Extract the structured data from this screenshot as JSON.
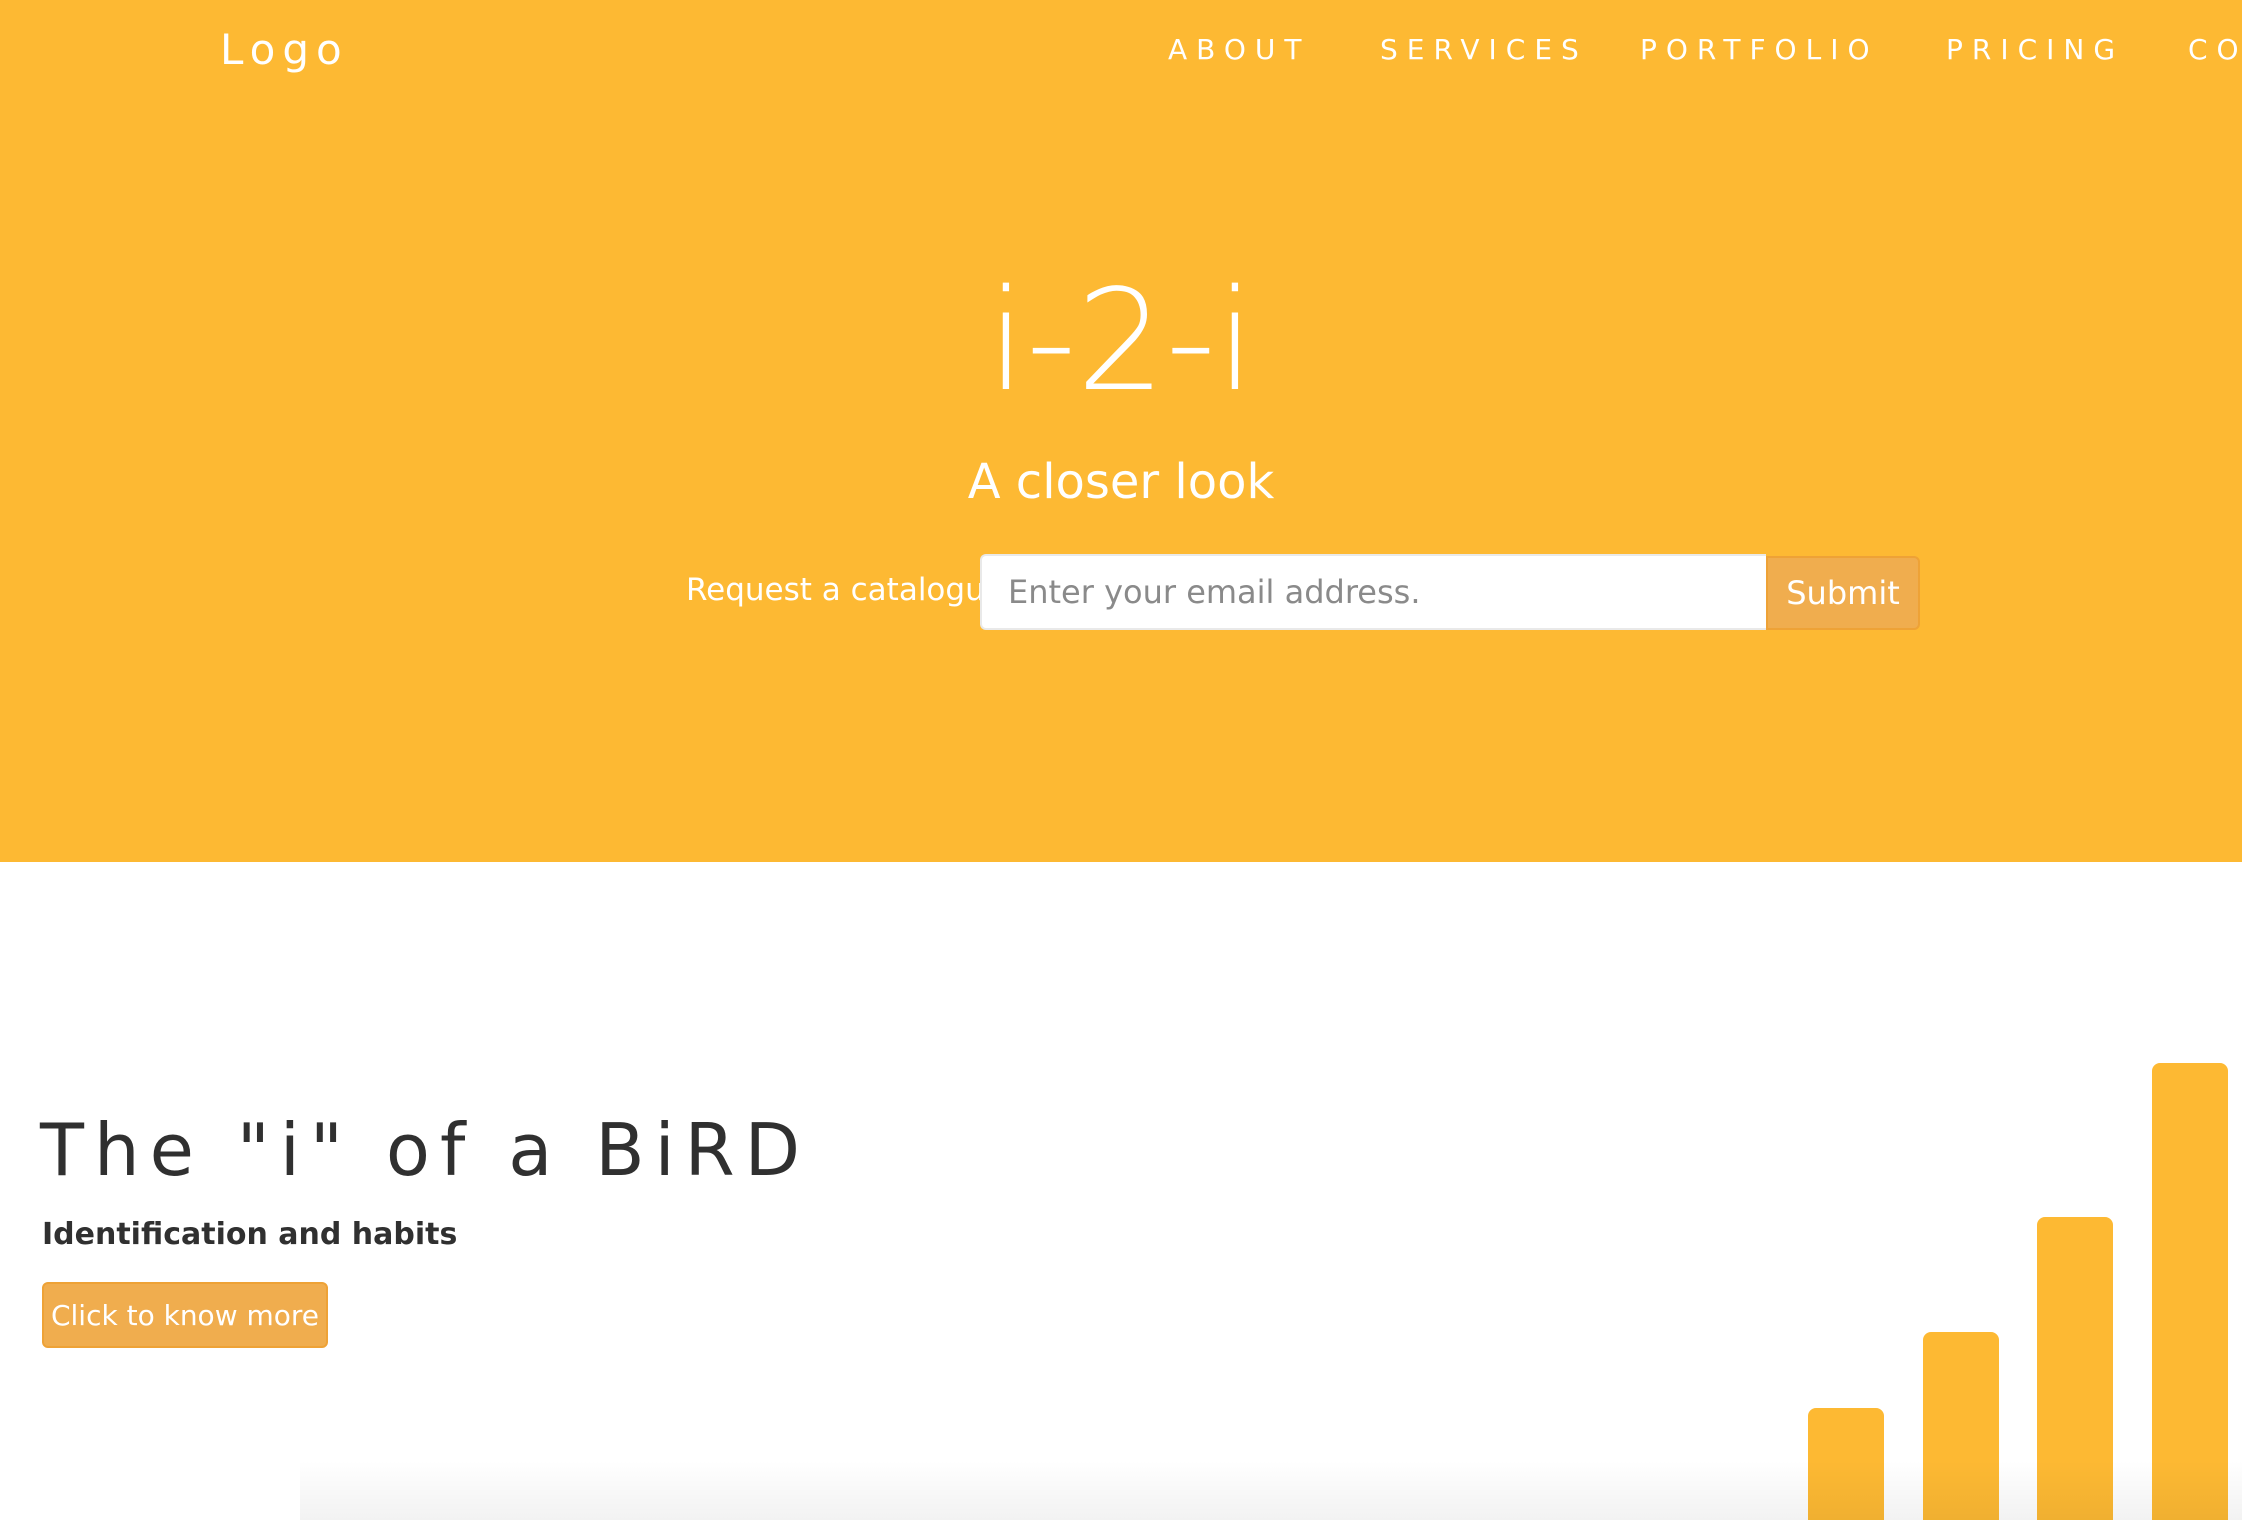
{
  "header": {
    "logo": "Logo",
    "nav": [
      {
        "label": "ABOUT"
      },
      {
        "label": "SERVICES"
      },
      {
        "label": "PORTFOLIO"
      },
      {
        "label": "PRICING"
      },
      {
        "label": "CO"
      }
    ]
  },
  "hero": {
    "title": "i-2-i",
    "subtitle": "A closer look",
    "catalogue_label": "Request a catalogue:",
    "email_placeholder": "Enter your email address.",
    "submit_label": "Submit"
  },
  "section": {
    "title": "The \"i\" of a BiRD",
    "subtitle": "Identification and habits",
    "button_label": "Click to know more"
  },
  "colors": {
    "brand": "#fdb933",
    "button": "#f0ad4e",
    "text_dark": "#303030"
  }
}
